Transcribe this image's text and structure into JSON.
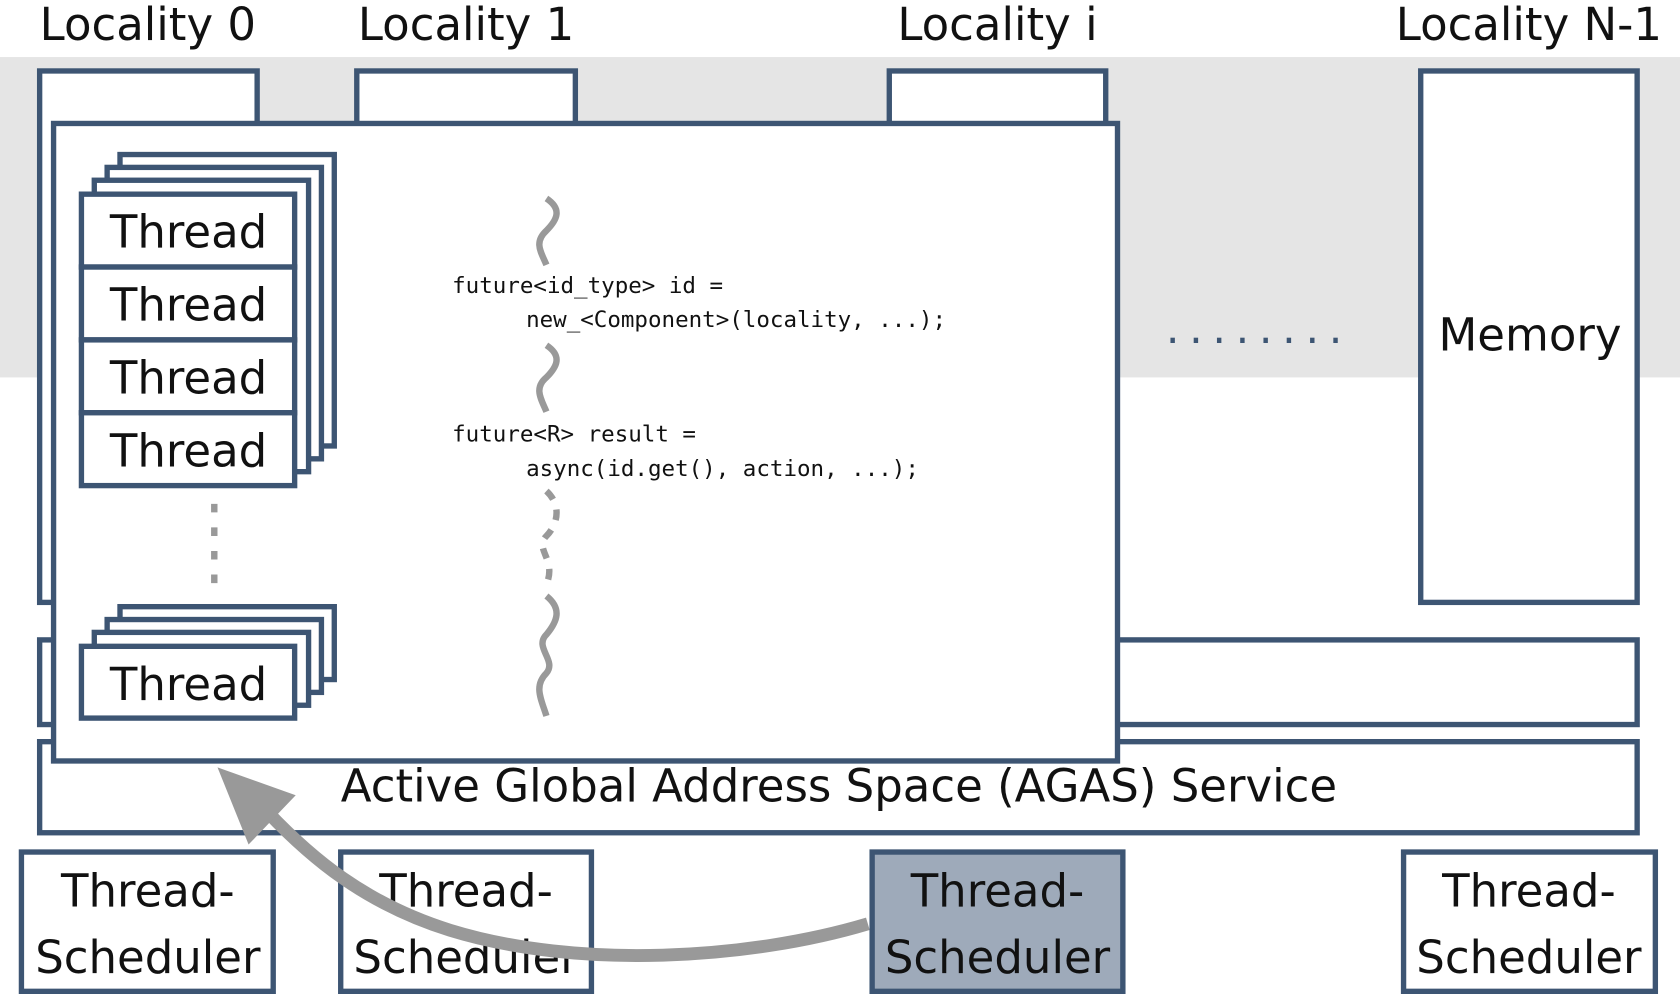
{
  "localities": [
    "Locality 0",
    "Locality 1",
    "Locality i",
    "Locality N-1"
  ],
  "memory_label": "Memory",
  "thread_label": "Thread",
  "agas_label": "Active Global Address Space (AGAS) Service",
  "code": {
    "line1": "future<id_type> id =",
    "line2": "new_<Component>(locality, ...);",
    "line3": "future<R> result =",
    "line4": "async(id.get(), action, ...);"
  },
  "ellipsis": "........",
  "schedulers": [
    {
      "line1": "Thread-",
      "line2": "Scheduler",
      "highlighted": false
    },
    {
      "line1": "Thread-",
      "line2": "Scheduler",
      "highlighted": false
    },
    {
      "line1": "Thread-",
      "line2": "Scheduler",
      "highlighted": true
    },
    {
      "line1": "Thread-",
      "line2": "Scheduler",
      "highlighted": false
    }
  ],
  "colors": {
    "border": "#3d5573",
    "band": "#e5e5e5",
    "highlight": "#9eaaba",
    "arrow": "#999999"
  }
}
